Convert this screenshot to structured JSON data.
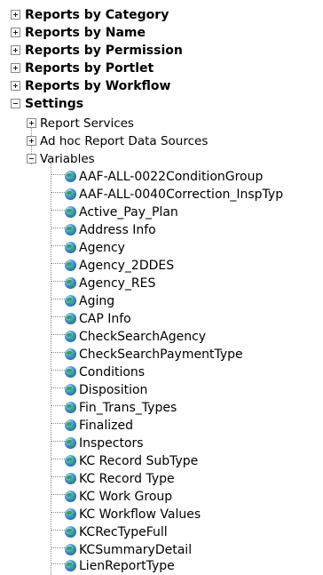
{
  "tree": {
    "top_level": [
      {
        "label": "Reports by Category",
        "expanded": false
      },
      {
        "label": "Reports by Name",
        "expanded": false
      },
      {
        "label": "Reports by Permission",
        "expanded": false
      },
      {
        "label": "Reports by Portlet",
        "expanded": false
      },
      {
        "label": "Reports by Workflow",
        "expanded": false
      },
      {
        "label": "Settings",
        "expanded": true
      }
    ],
    "settings_children": [
      {
        "label": "Report Services",
        "expanded": false
      },
      {
        "label": "Ad hoc Report Data Sources",
        "expanded": false
      },
      {
        "label": "Variables",
        "expanded": true
      }
    ],
    "variables": [
      "AAF-ALL-0022ConditionGroup",
      "AAF-ALL-0040Correction_InspTyp",
      "Active_Pay_Plan",
      "Address Info",
      "Agency",
      "Agency_2DDES",
      "Agency_RES",
      "Aging",
      "CAP Info",
      "CheckSearchAgency",
      "CheckSearchPaymentType",
      "Conditions",
      "Disposition",
      "Fin_Trans_Types",
      "Finalized",
      "Inspectors",
      "KC Record SubType",
      "KC Record Type",
      "KC Work Group",
      "KC Workflow Values",
      "KCRecTypeFull",
      "KCSummaryDetail",
      "LienReportType"
    ],
    "icons": {
      "collapsed": "plus-box-icon",
      "expanded": "minus-box-icon",
      "variable": "globe-icon"
    }
  }
}
